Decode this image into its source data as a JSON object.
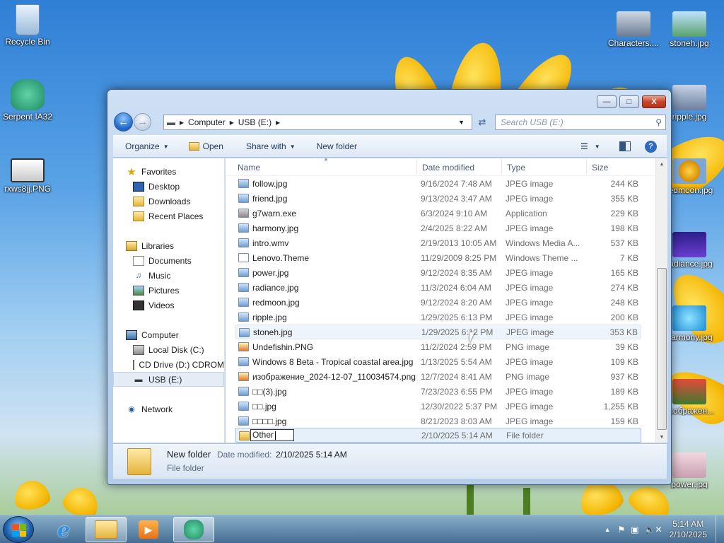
{
  "desktop": {
    "left_icons": [
      {
        "label": "Recycle Bin"
      },
      {
        "label": "Serpent IA32"
      },
      {
        "label": "rxws8jj.PNG"
      }
    ],
    "right_icons": [
      {
        "label": "Characters...."
      },
      {
        "label": "stoneh.jpg"
      },
      {
        "label": "ripple.jpg"
      },
      {
        "label": "redmoon.jpg"
      },
      {
        "label": "radiance.jpg"
      },
      {
        "label": "harmony.jpg"
      },
      {
        "label": "изображен..."
      },
      {
        "label": "power.jpg"
      }
    ]
  },
  "window": {
    "controls": {
      "minimize": "—",
      "maximize": "□",
      "close": "X"
    },
    "address": {
      "crumbs": [
        "Computer",
        "USB (E:)"
      ]
    },
    "search_placeholder": "Search USB (E:)",
    "toolbar": {
      "organize": "Organize",
      "open": "Open",
      "share_with": "Share with",
      "new_folder": "New folder"
    },
    "nav": {
      "favorites": "Favorites",
      "favorites_items": [
        "Desktop",
        "Downloads",
        "Recent Places"
      ],
      "libraries": "Libraries",
      "libraries_items": [
        "Documents",
        "Music",
        "Pictures",
        "Videos"
      ],
      "computer": "Computer",
      "computer_items": [
        "Local Disk (C:)",
        "CD Drive (D:) CDROM",
        "USB (E:)"
      ],
      "network": "Network"
    },
    "columns": {
      "name": "Name",
      "date": "Date modified",
      "type": "Type",
      "size": "Size"
    },
    "files": [
      {
        "name": "follow.jpg",
        "date": "9/16/2024 7:48 AM",
        "type": "JPEG image",
        "size": "244 KB"
      },
      {
        "name": "friend.jpg",
        "date": "9/13/2024 3:47 AM",
        "type": "JPEG image",
        "size": "355 KB"
      },
      {
        "name": "g7warn.exe",
        "date": "6/3/2024 9:10 AM",
        "type": "Application",
        "size": "229 KB"
      },
      {
        "name": "harmony.jpg",
        "date": "2/4/2025 8:22 AM",
        "type": "JPEG image",
        "size": "198 KB"
      },
      {
        "name": "intro.wmv",
        "date": "2/19/2013 10:05 AM",
        "type": "Windows Media A...",
        "size": "537 KB"
      },
      {
        "name": "Lenovo.Theme",
        "date": "11/29/2009 8:25 PM",
        "type": "Windows Theme ...",
        "size": "7 KB"
      },
      {
        "name": "power.jpg",
        "date": "9/12/2024 8:35 AM",
        "type": "JPEG image",
        "size": "165 KB"
      },
      {
        "name": "radiance.jpg",
        "date": "11/3/2024 6:04 AM",
        "type": "JPEG image",
        "size": "274 KB"
      },
      {
        "name": "redmoon.jpg",
        "date": "9/12/2024 8:20 AM",
        "type": "JPEG image",
        "size": "248 KB"
      },
      {
        "name": "ripple.jpg",
        "date": "1/29/2025 6:13 PM",
        "type": "JPEG image",
        "size": "200 KB"
      },
      {
        "name": "stoneh.jpg",
        "date": "1/29/2025 6:12 PM",
        "type": "JPEG image",
        "size": "353 KB"
      },
      {
        "name": "Undefishin.PNG",
        "date": "11/2/2024 2:59 PM",
        "type": "PNG image",
        "size": "39 KB"
      },
      {
        "name": "Windows 8 Beta - Tropical coastal area.jpg",
        "date": "1/13/2025 5:54 AM",
        "type": "JPEG image",
        "size": "109 KB"
      },
      {
        "name": "изображение_2024-12-07_110034574.png",
        "date": "12/7/2024 8:41 AM",
        "type": "PNG image",
        "size": "937 KB"
      },
      {
        "name": "□□(3).jpg",
        "date": "7/23/2023 6:55 PM",
        "type": "JPEG image",
        "size": "189 KB"
      },
      {
        "name": "□□.jpg",
        "date": "12/30/2022 5:37 PM",
        "type": "JPEG image",
        "size": "1,255 KB"
      },
      {
        "name": "□□□□.jpg",
        "date": "8/21/2023 8:03 AM",
        "type": "JPEG image",
        "size": "159 KB"
      }
    ],
    "editing_row": {
      "name": "Other",
      "date": "2/10/2025 5:14 AM",
      "type": "File folder"
    },
    "details": {
      "name": "New folder",
      "date_label": "Date modified:",
      "date_value": "2/10/2025 5:14 AM",
      "kind": "File folder"
    }
  },
  "taskbar": {
    "time": "5:14 AM",
    "date": "2/10/2025"
  }
}
